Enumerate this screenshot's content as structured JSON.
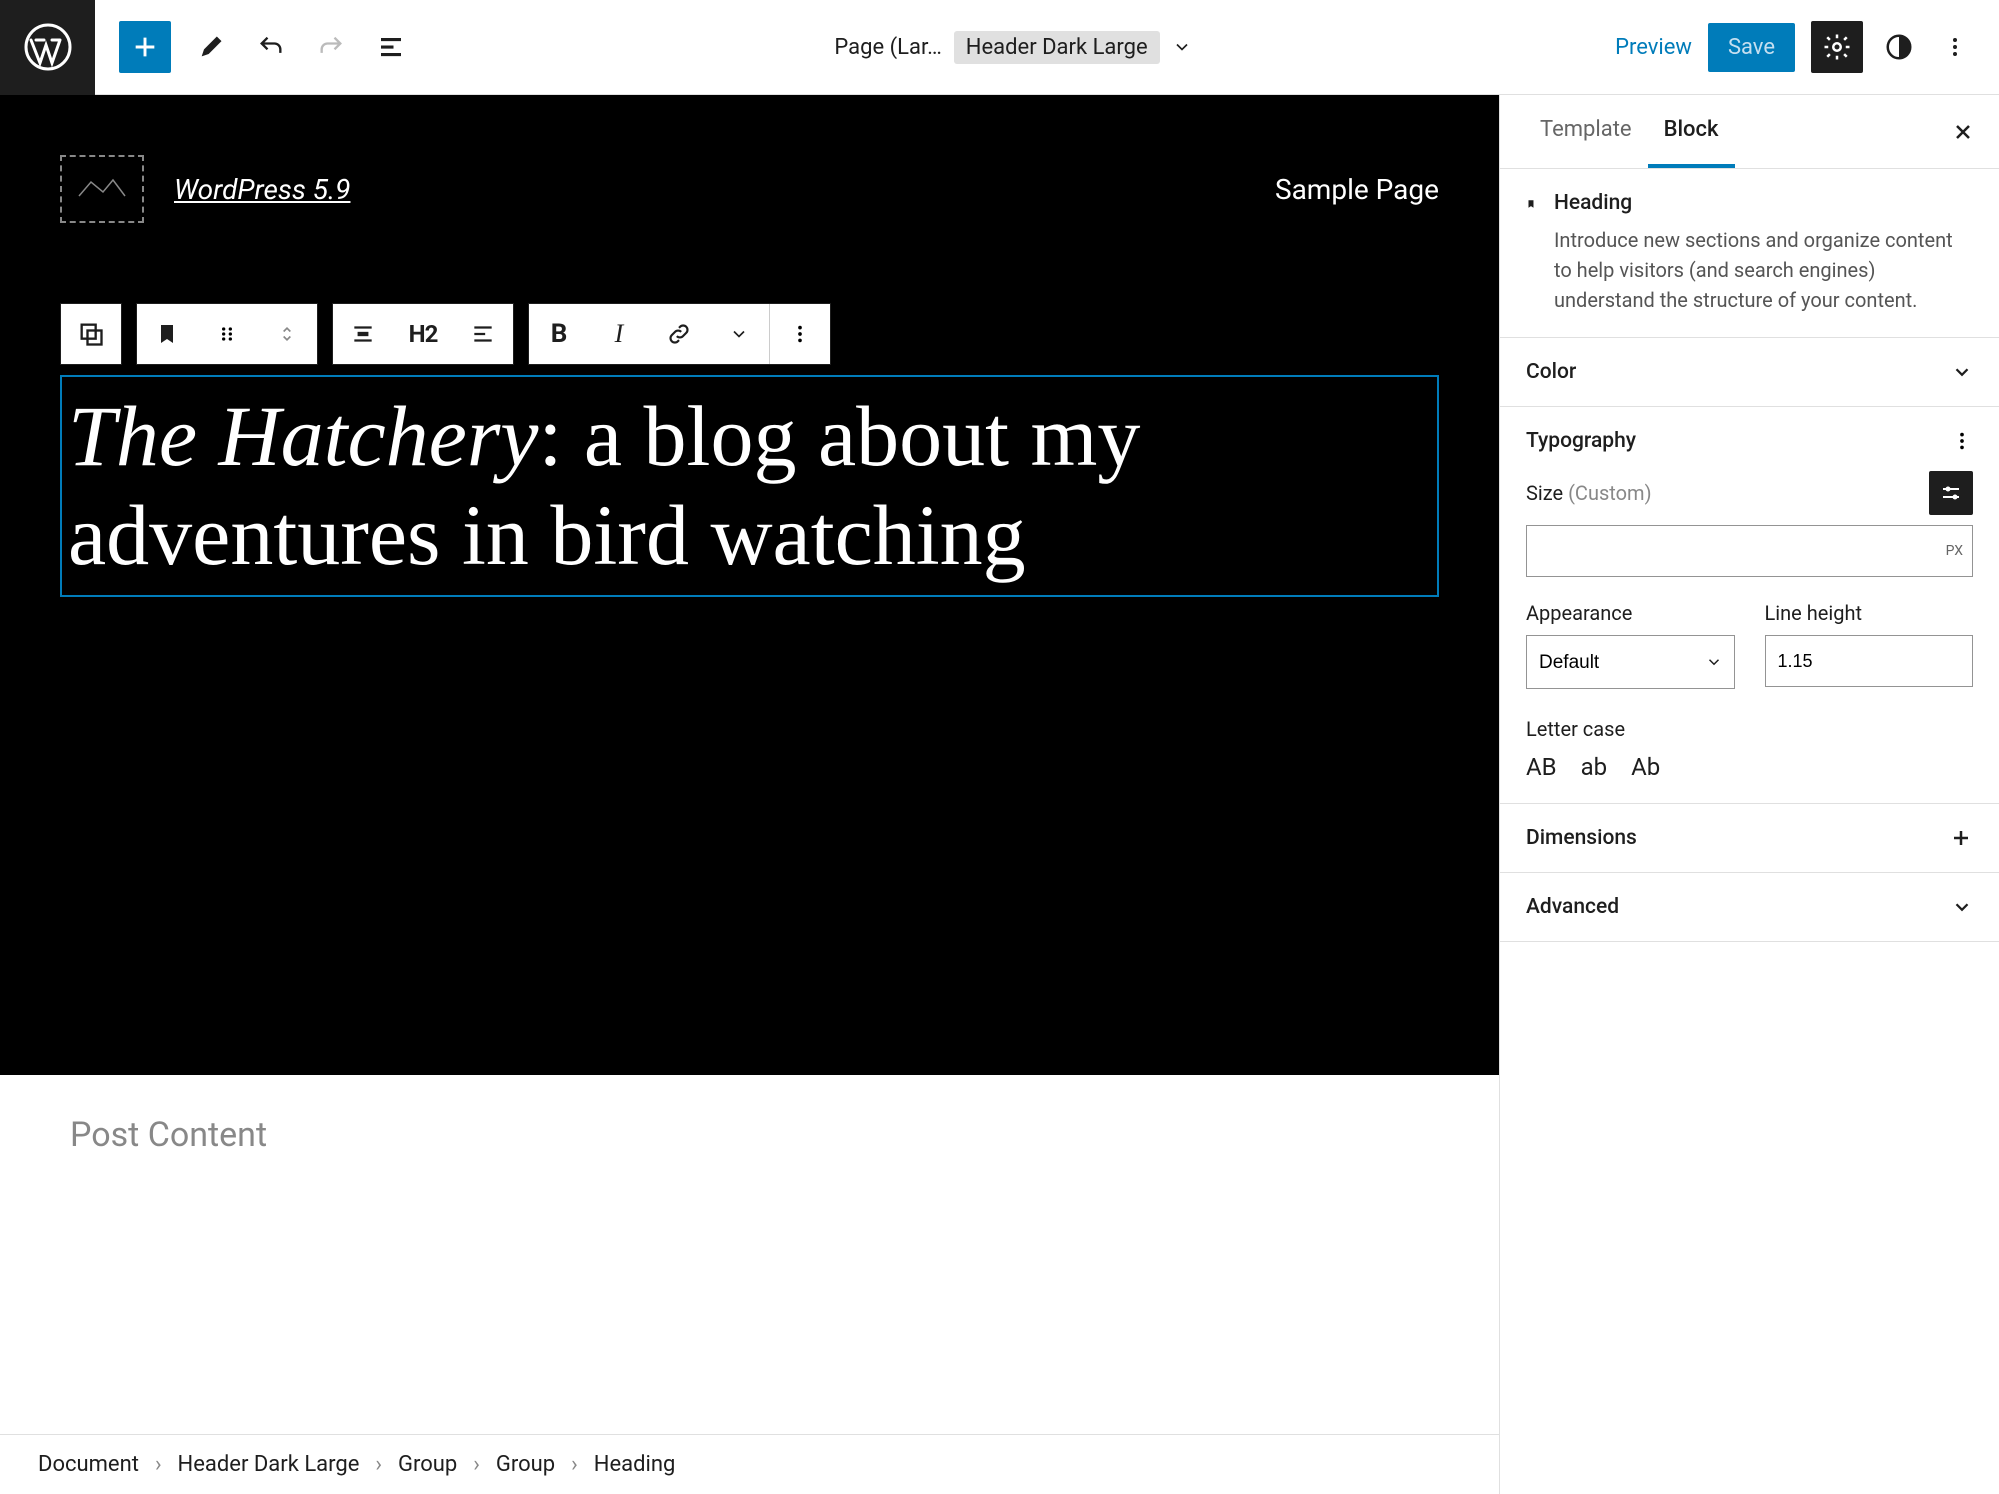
{
  "topbar": {
    "doc_label": "Page (Lar…",
    "template_name": "Header Dark Large",
    "preview": "Preview",
    "save": "Save"
  },
  "canvas": {
    "site_title": "WordPress 5.9",
    "nav_item": "Sample Page",
    "heading_em": "The Hatchery",
    "heading_rest": ": a blog about my adventures in bird watching",
    "toolbar_h2": "H2",
    "post_content_placeholder": "Post Content"
  },
  "sidebar": {
    "tabs": {
      "template": "Template",
      "block": "Block"
    },
    "block_info": {
      "title": "Heading",
      "desc": "Introduce new sections and organize content to help visitors (and search engines) understand the structure of your content."
    },
    "panels": {
      "color": "Color",
      "typography": "Typography",
      "dimensions": "Dimensions",
      "advanced": "Advanced"
    },
    "typography": {
      "size_label": "Size",
      "size_hint": "(Custom)",
      "size_unit": "PX",
      "appearance_label": "Appearance",
      "appearance_value": "Default",
      "line_height_label": "Line height",
      "line_height_value": "1.15",
      "letter_case_label": "Letter case",
      "letter_case_opts": [
        "AB",
        "ab",
        "Ab"
      ]
    }
  },
  "breadcrumb": [
    "Document",
    "Header Dark Large",
    "Group",
    "Group",
    "Heading"
  ]
}
